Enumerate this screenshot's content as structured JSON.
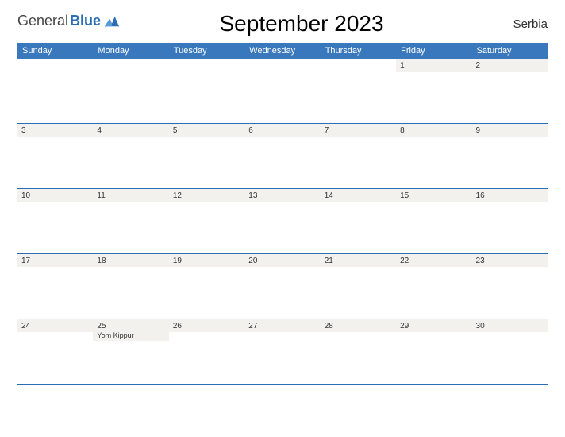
{
  "brand": {
    "general": "General",
    "blue": "Blue"
  },
  "title": "September 2023",
  "region": "Serbia",
  "daynames": [
    "Sunday",
    "Monday",
    "Tuesday",
    "Wednesday",
    "Thursday",
    "Friday",
    "Saturday"
  ],
  "weeks": [
    [
      {
        "n": ""
      },
      {
        "n": ""
      },
      {
        "n": ""
      },
      {
        "n": ""
      },
      {
        "n": ""
      },
      {
        "n": "1"
      },
      {
        "n": "2"
      }
    ],
    [
      {
        "n": "3"
      },
      {
        "n": "4"
      },
      {
        "n": "5"
      },
      {
        "n": "6"
      },
      {
        "n": "7"
      },
      {
        "n": "8"
      },
      {
        "n": "9"
      }
    ],
    [
      {
        "n": "10"
      },
      {
        "n": "11"
      },
      {
        "n": "12"
      },
      {
        "n": "13"
      },
      {
        "n": "14"
      },
      {
        "n": "15"
      },
      {
        "n": "16"
      }
    ],
    [
      {
        "n": "17"
      },
      {
        "n": "18"
      },
      {
        "n": "19"
      },
      {
        "n": "20"
      },
      {
        "n": "21"
      },
      {
        "n": "22"
      },
      {
        "n": "23"
      }
    ],
    [
      {
        "n": "24"
      },
      {
        "n": "25",
        "e": "Yom Kippur"
      },
      {
        "n": "26"
      },
      {
        "n": "27"
      },
      {
        "n": "28"
      },
      {
        "n": "29"
      },
      {
        "n": "30"
      }
    ]
  ]
}
